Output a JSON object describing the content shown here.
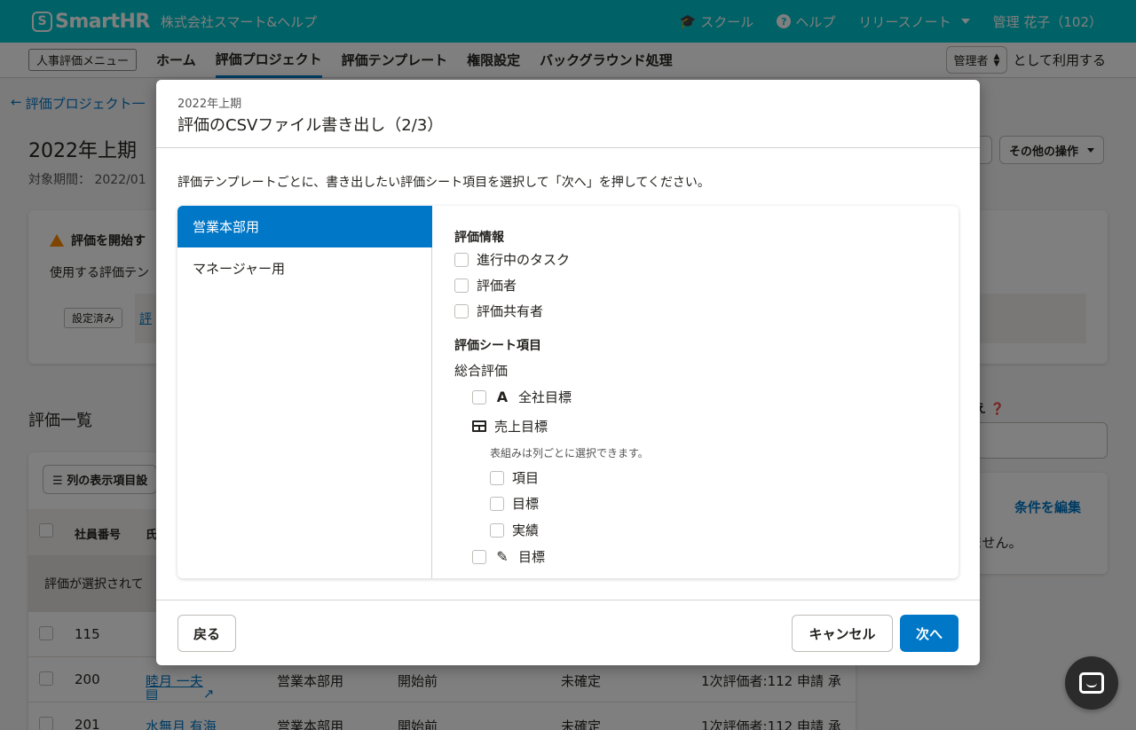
{
  "header": {
    "logo_mark": "S",
    "logo_text": "SmartHR",
    "company": "株式会社スマート&ヘルプ",
    "nav": {
      "school": "スクール",
      "help": "ヘルプ",
      "release_notes": "リリースノート",
      "user": "管理 花子（102）"
    }
  },
  "subnav": {
    "menu_badge": "人事評価メニュー",
    "tabs": [
      "ホーム",
      "評価プロジェクト",
      "評価テンプレート",
      "権限設定",
      "バックグラウンド処理"
    ],
    "role_value": "管理者",
    "role_suffix": "として利用する"
  },
  "page": {
    "back_link": "評価プロジェクト一",
    "title": "2022年上期",
    "period": "対象期間： 2022/01",
    "other_actions": "その他の操作",
    "warning_title": "評価を開始す",
    "warning_body": "使用する評価テン",
    "warning_tag": "設定済み",
    "warning_link": "評",
    "list_title": "評価一覧",
    "column_button": "列の表示項目設",
    "table_headers": [
      "社員番号",
      "氏"
    ],
    "selection_text": "評価が選択されて",
    "rows": [
      {
        "id": "115",
        "name": "",
        "template": "",
        "status": "",
        "result": "",
        "evaluator": ""
      },
      {
        "id": "200",
        "name": "睦月 一夫",
        "template": "営業本部用",
        "status": "開始前",
        "result": "未確定",
        "evaluator": "1次評価者:112 申請 承"
      },
      {
        "id": "201",
        "name": "水無月 有海",
        "template": "営業本部用",
        "status": "開始前",
        "result": "未確定",
        "evaluator": "1次評価者:112 申請 承"
      }
    ],
    "side_label": "え",
    "side_link": "条件を編集",
    "side_text": "ません。"
  },
  "modal": {
    "subtitle": "2022年上期",
    "title": "評価のCSVファイル書き出し（2/3）",
    "description": "評価テンプレートごとに、書き出したい評価シート項目を選択して「次へ」を押してください。",
    "templates": [
      "営業本部用",
      "マネージャー用"
    ],
    "section_info": "評価情報",
    "info_items": [
      "進行中のタスク",
      "評価者",
      "評価共有者"
    ],
    "section_sheet": "評価シート項目",
    "group_label": "総合評価",
    "item_company_goal": "全社目標",
    "item_sales_goal": "売上目標",
    "table_note": "表組みは列ごとに選択できます。",
    "table_columns": [
      "項目",
      "目標",
      "実績"
    ],
    "item_goal": "目標",
    "back_button": "戻る",
    "cancel_button": "キャンセル",
    "next_button": "次へ"
  },
  "colors": {
    "brand": "#00c4cc",
    "primary": "#0077c7"
  }
}
